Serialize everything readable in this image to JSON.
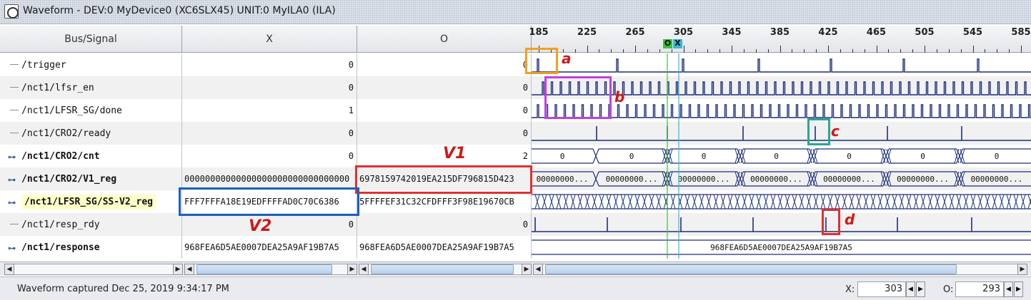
{
  "window": {
    "title": "Waveform - DEV:0 MyDevice0 (XC6SLX45) UNIT:0 MyILA0 (ILA)",
    "icon": "waveform-app-icon"
  },
  "columns": {
    "signal": "Bus/Signal",
    "x": "X",
    "o": "O"
  },
  "ruler": {
    "ticks": [
      "185",
      "225",
      "265",
      "305",
      "345",
      "385",
      "425",
      "465",
      "505",
      "545",
      "585"
    ],
    "cursor_o": "O",
    "cursor_x": "X"
  },
  "signals": [
    {
      "name": "/trigger",
      "type": "bit",
      "x": "0",
      "o": "0"
    },
    {
      "name": "/nct1/lfsr_en",
      "type": "bit",
      "x": "0",
      "o": "0"
    },
    {
      "name": "/nct1/LFSR_SG/done",
      "type": "bit",
      "x": "1",
      "o": "0"
    },
    {
      "name": "/nct1/CRO2/ready",
      "type": "bit",
      "x": "0",
      "o": "0"
    },
    {
      "name": "/nct1/CRO2/cnt",
      "type": "bus",
      "x": "0",
      "o": "2"
    },
    {
      "name": "/nct1/CRO2/V1_reg",
      "type": "bus",
      "x": "00000000000000000000000000000000",
      "o": "6978159742019EA215DF796815D423"
    },
    {
      "name": "/nct1/LFSR_SG/SS-V2_reg",
      "type": "bus",
      "x": "FFF7FFFA18E19EDFFFFAD0C70C6386",
      "o": "5FFFFEF31C32CFDFFF3F98E19670CB"
    },
    {
      "name": "/nct1/resp_rdy",
      "type": "bit",
      "x": "0",
      "o": "0"
    },
    {
      "name": "/nct1/response",
      "type": "bus",
      "x": "968FEA6D5AE0007DEA25A9AF19B7A5",
      "o": "968FEA6D5AE0007DEA25A9AF19B7A5"
    }
  ],
  "bus_labels": {
    "cnt": "0",
    "v1": "000000...",
    "v1_long": "00000000...",
    "response": "968FEA6D5AE0007DEA25A9AF19B7A5"
  },
  "annotations": {
    "a": "a",
    "b": "b",
    "c": "c",
    "d": "d",
    "v1": "V1",
    "v2": "V2"
  },
  "status": {
    "message": "Waveform captured Dec 25, 2019 9:34:17 PM",
    "x_label": "X:",
    "x_value": "303",
    "o_label": "O:",
    "o_value": "293"
  },
  "colors": {
    "wave": "#1f2f7a",
    "cursor_o": "#3cc03c",
    "cursor_x": "#38b8d8",
    "annot_a": "#f0a020",
    "annot_b": "#c040e0",
    "annot_c": "#2aa890",
    "annot_red": "#e03030",
    "annot_blue": "#1a60c0"
  }
}
